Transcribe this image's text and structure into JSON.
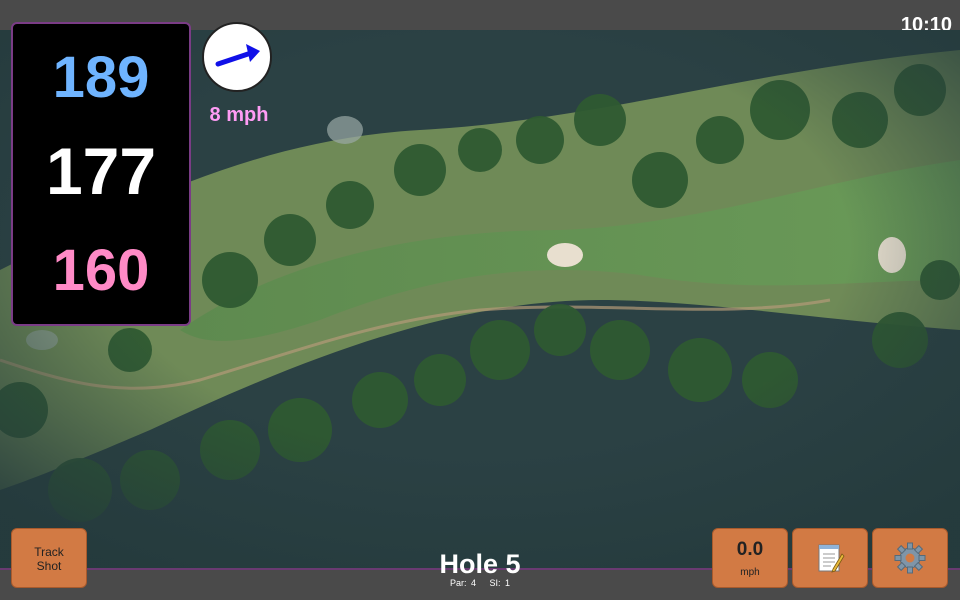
{
  "status": {
    "clock": "10:10"
  },
  "distances": {
    "back": "189",
    "middle": "177",
    "front": "160"
  },
  "wind": {
    "speed": "8 mph",
    "direction_icon": "arrow-icon",
    "arrow_color": "#1010e8"
  },
  "buttons": {
    "track_shot": "Track\nShot",
    "speed_value": "0.0",
    "speed_unit": "mph",
    "notes_icon": "notepad-icon",
    "settings_icon": "gear-icon"
  },
  "hole": {
    "title": "Hole 5",
    "info": "Par: 4   SI: 1"
  },
  "colors": {
    "accent_border": "#7a3c86",
    "button": "#d27a44",
    "back_distance": "#6fb4ff",
    "front_distance": "#ff8ac6",
    "wind_text": "#ff9cf5"
  }
}
